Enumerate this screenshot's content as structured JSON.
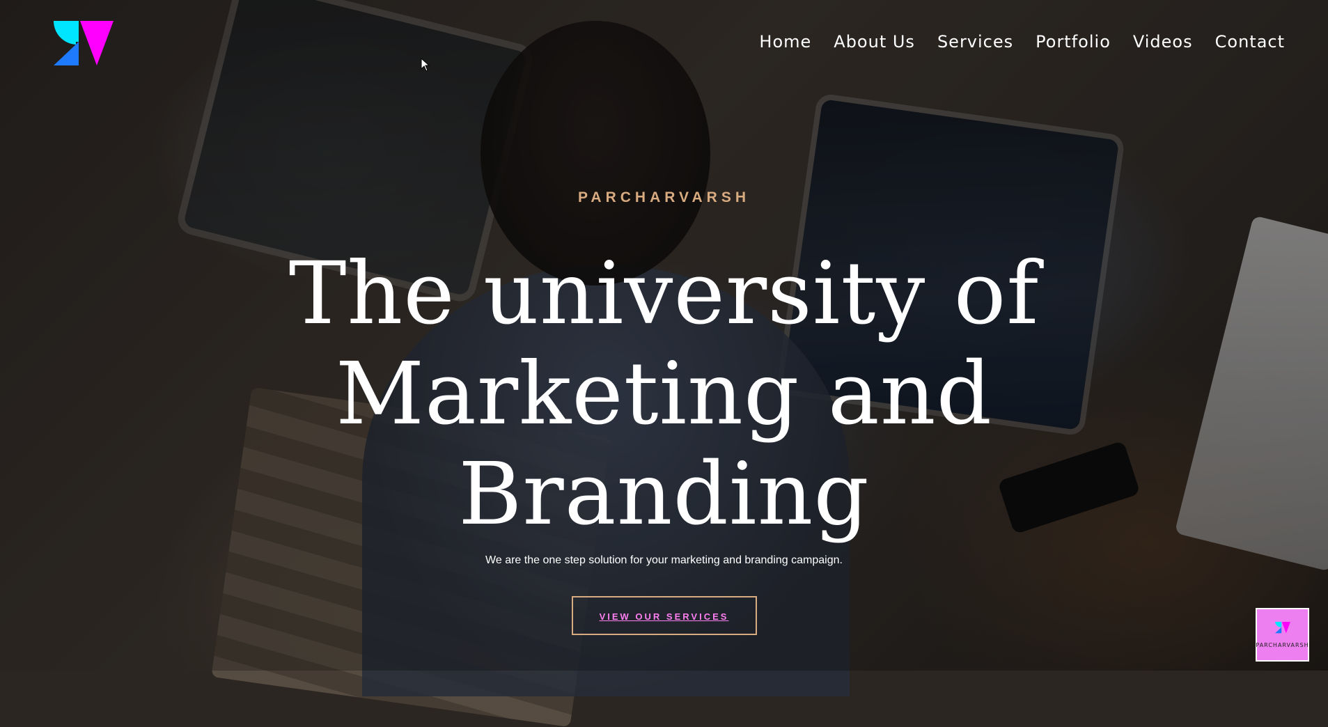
{
  "brand": {
    "logo_icon": "brand-logo-icon",
    "colors": {
      "cyan": "#00e5ff",
      "blue": "#1e7bff",
      "magenta": "#ff00ff"
    }
  },
  "nav": {
    "items": [
      {
        "label": "Home"
      },
      {
        "label": "About Us"
      },
      {
        "label": "Services"
      },
      {
        "label": "Portfolio"
      },
      {
        "label": "Videos"
      },
      {
        "label": "Contact"
      }
    ]
  },
  "hero": {
    "eyebrow": "PARCHARVARSH",
    "title_line1": "The university of",
    "title_line2": "Marketing and Branding",
    "subtitle": "We are the one step solution for your marketing and branding campaign.",
    "cta_label": "VIEW OUR SERVICES",
    "colors": {
      "eyebrow": "#d9ab80",
      "cta_text": "#ff7ff0",
      "cta_border": "#d9ab80"
    }
  },
  "chat_widget": {
    "label": "PARCHARVARSH",
    "background": "#ee7ff0"
  }
}
